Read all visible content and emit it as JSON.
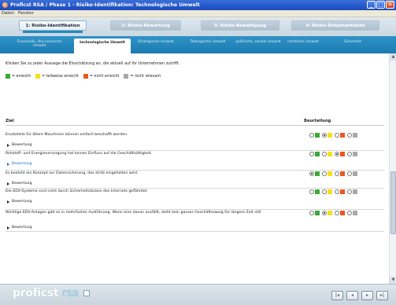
{
  "window": {
    "title": "Proficst RSA / Phase 1 - Risiko-Identifikation: Technologische Umwelt",
    "buttons": [
      "_",
      "□",
      "✕"
    ]
  },
  "menu": [
    "Daten",
    "Fenster"
  ],
  "phases": [
    {
      "label": "1: Risiko-Identifikation",
      "active": true
    },
    {
      "label": "2: Risiko-Bewertung",
      "active": false
    },
    {
      "label": "3: Risiko-Bewältigung",
      "active": false
    },
    {
      "label": "4: Risiko-Dokumentation",
      "active": false
    }
  ],
  "subtabs": [
    {
      "label": "Finanzielle, öko-nomische Umwelt",
      "active": false
    },
    {
      "label": "technologische Umwelt",
      "active": true
    },
    {
      "label": "Strategische Umwelt",
      "active": false
    },
    {
      "label": "Ökologische Umwelt",
      "active": false
    },
    {
      "label": "politische, soziale Umwelt",
      "active": false
    },
    {
      "label": "rechtliche Umwelt",
      "active": false
    },
    {
      "label": "Sicherheit",
      "active": false
    }
  ],
  "instructions": "Klicken Sie zu jeder Aussage die Einschätzung an, die aktuell auf Ihr Unternehmen zutrifft.",
  "legend": [
    {
      "color": "#3aaa35",
      "label": "= erreicht"
    },
    {
      "color": "#f5e01a",
      "label": "= teilweise erreicht"
    },
    {
      "color": "#e8581f",
      "label": "= nicht erreicht"
    },
    {
      "color": "#a8a8a8",
      "label": "= nicht relevant"
    }
  ],
  "table": {
    "col_goal": "Ziel",
    "col_rating": "Beurteilung",
    "expand_label": "Bewertung",
    "rows": [
      {
        "goal": "Ersatzteile für ältere Maschinen können einfach beschafft werden.",
        "selected": 1,
        "expand_link": false
      },
      {
        "goal": "Rohstoff- und Energieversorgung hat keinen Einfluss auf die Geschäftstätigkeit.",
        "selected": 2,
        "expand_link": true
      },
      {
        "goal": "Es besteht ein Konzept zur Datensicherung, das strikt eingehalten wird.",
        "selected": 0,
        "expand_link": false
      },
      {
        "goal": "Die EDV-Systeme sind nicht durch Sicherheitslücken des Internets gefährdet.",
        "selected": -1,
        "expand_link": false
      },
      {
        "goal": "Wichtige EDV-Anlagen gibt es in mehrfacher Ausführung. Wenn eine davon ausfällt, steht kein ganzer Geschäftszweig für längere Zeit still.",
        "selected": 1,
        "expand_link": false
      }
    ]
  },
  "footer": {
    "logo_main": "proficst",
    "logo_sub": "rsa",
    "nav": [
      "|◂",
      "◂",
      "▸",
      "▸|"
    ]
  },
  "colors": {
    "achieved": "#3aaa35",
    "partial": "#f5e01a",
    "not_achieved": "#e8581f",
    "not_relevant": "#a8a8a8"
  }
}
